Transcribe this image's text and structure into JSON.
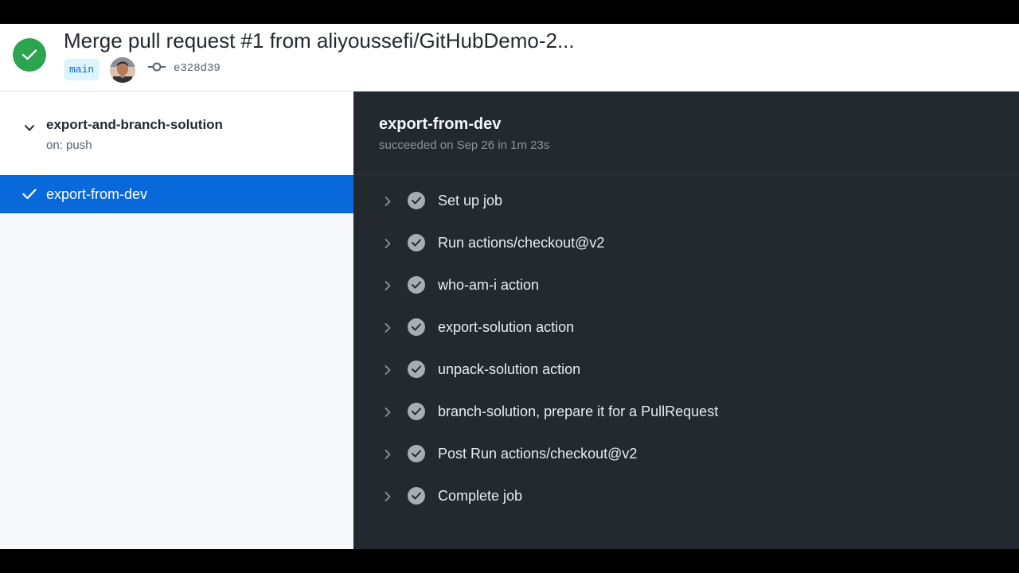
{
  "header": {
    "commit_title": "Merge pull request #1 from aliyoussefi/GitHubDemo-2...",
    "branch": "main",
    "commit_sha": "e328d39",
    "status_icon": "check-circle-icon",
    "status_color": "#2da44e"
  },
  "sidebar": {
    "workflow_name": "export-and-branch-solution",
    "workflow_trigger": "on: push",
    "jobs": [
      {
        "label": "export-from-dev",
        "status": "success",
        "selected": true
      }
    ],
    "selected_color": "#0969da"
  },
  "job": {
    "title": "export-from-dev",
    "summary": "succeeded on Sep 26 in 1m 23s",
    "steps": [
      {
        "label": "Set up job",
        "status": "success"
      },
      {
        "label": "Run actions/checkout@v2",
        "status": "success"
      },
      {
        "label": "who-am-i action",
        "status": "success"
      },
      {
        "label": "export-solution action",
        "status": "success"
      },
      {
        "label": "unpack-solution action",
        "status": "success"
      },
      {
        "label": "branch-solution, prepare it for a PullRequest",
        "status": "success"
      },
      {
        "label": "Post Run actions/checkout@v2",
        "status": "success"
      },
      {
        "label": "Complete job",
        "status": "success"
      }
    ]
  }
}
